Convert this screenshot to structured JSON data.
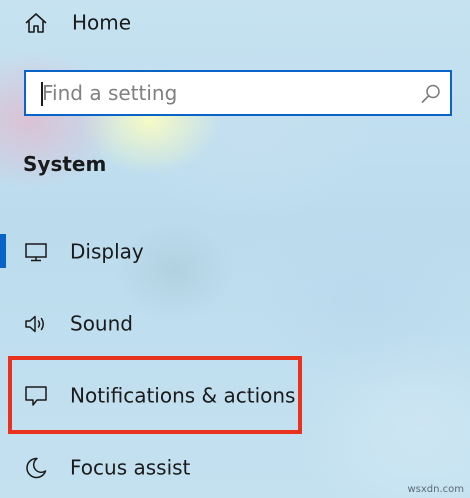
{
  "nav": {
    "home": {
      "label": "Home",
      "icon": "home-icon"
    }
  },
  "search": {
    "placeholder": "Find a setting",
    "value": "",
    "icon": "search-icon"
  },
  "section": {
    "title": "System"
  },
  "menu": {
    "items": [
      {
        "label": "Display",
        "icon": "monitor-icon",
        "selected": true
      },
      {
        "label": "Sound",
        "icon": "speaker-icon",
        "selected": false
      },
      {
        "label": "Notifications & actions",
        "icon": "speech-bubble-icon",
        "selected": false
      },
      {
        "label": "Focus assist",
        "icon": "moon-icon",
        "selected": false
      }
    ]
  },
  "annotation": {
    "highlight_target": "Notifications & actions",
    "highlight_color": "#e8321e"
  },
  "colors": {
    "accent": "#0a64c8",
    "text": "#1a1a1a",
    "placeholder": "#808080"
  },
  "watermark": {
    "text": "wsxdn.com"
  }
}
